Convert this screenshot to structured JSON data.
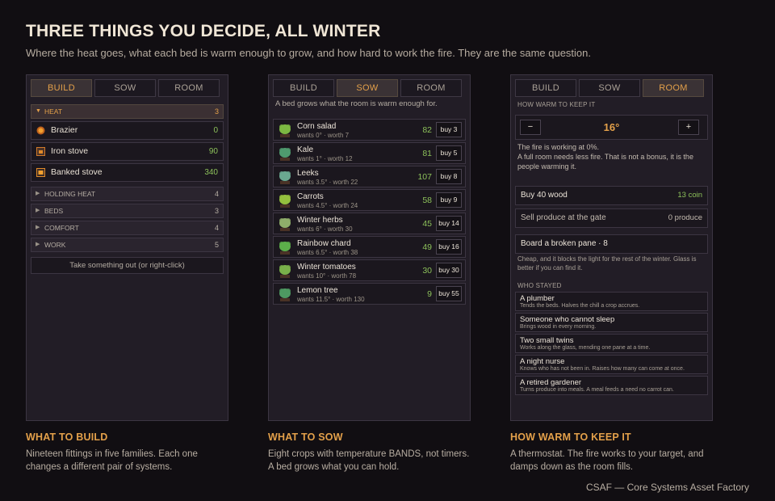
{
  "header": {
    "title": "THREE THINGS YOU DECIDE, ALL WINTER",
    "subtitle": "Where the heat goes, what each bed is warm enough to grow, and how hard to work the fire. They are the same question."
  },
  "tabs": [
    "BUILD",
    "SOW",
    "ROOM"
  ],
  "build": {
    "open_category": {
      "name": "HEAT",
      "count": "3"
    },
    "fittings": [
      {
        "name": "Brazier",
        "cost": "0",
        "icon": "brazier-icon"
      },
      {
        "name": "Iron stove",
        "cost": "90",
        "icon": "iron-stove-icon"
      },
      {
        "name": "Banked stove",
        "cost": "340",
        "icon": "banked-stove-icon"
      }
    ],
    "categories": [
      {
        "name": "HOLDING HEAT",
        "count": "4"
      },
      {
        "name": "BEDS",
        "count": "3"
      },
      {
        "name": "COMFORT",
        "count": "4"
      },
      {
        "name": "WORK",
        "count": "5"
      }
    ],
    "take_out": "Take something out  (or right-click)"
  },
  "sow": {
    "hint": "A bed grows what the room is warm enough for.",
    "crops": [
      {
        "name": "Corn salad",
        "meta": "wants 0°  ·  worth 7",
        "score": "82",
        "buy": "buy 3",
        "color": "#7cb842"
      },
      {
        "name": "Kale",
        "meta": "wants 1°  ·  worth 12",
        "score": "81",
        "buy": "buy 5",
        "color": "#4f9a6e"
      },
      {
        "name": "Leeks",
        "meta": "wants 3.5°  ·  worth 22",
        "score": "107",
        "buy": "buy 8",
        "color": "#6aa890"
      },
      {
        "name": "Carrots",
        "meta": "wants 4.5°  ·  worth 24",
        "score": "58",
        "buy": "buy 9",
        "color": "#94c03e"
      },
      {
        "name": "Winter herbs",
        "meta": "wants 6°  ·  worth 30",
        "score": "45",
        "buy": "buy 14",
        "color": "#8fae6a"
      },
      {
        "name": "Rainbow chard",
        "meta": "wants 6.5°  ·  worth 38",
        "score": "49",
        "buy": "buy 16",
        "color": "#5cae4a"
      },
      {
        "name": "Winter tomatoes",
        "meta": "wants 10°  ·  worth 78",
        "score": "30",
        "buy": "buy 30",
        "color": "#79b04a"
      },
      {
        "name": "Lemon tree",
        "meta": "wants 11.5°  ·  worth 130",
        "score": "9",
        "buy": "buy 55",
        "color": "#4e9a62"
      }
    ]
  },
  "room": {
    "section_warm": "HOW WARM TO KEEP IT",
    "minus": "−",
    "plus": "+",
    "temperature": "16°",
    "fire_status": "The fire is working at 0%.",
    "fire_note": "A full room needs less fire. That is not a bonus, it is the people warming it.",
    "buy_wood": {
      "label": "Buy 40 wood",
      "value": "13 coin"
    },
    "sell_produce": {
      "label": "Sell produce at the gate",
      "value": "0 produce"
    },
    "board_pane": "Board a broken pane  ·  8",
    "board_note": "Cheap, and it blocks the light for the rest of the winter. Glass is better if you can find it.",
    "section_stayed": "WHO STAYED",
    "people": [
      {
        "name": "A plumber",
        "desc": "Tends the beds. Halves the chill a crop accrues."
      },
      {
        "name": "Someone who cannot sleep",
        "desc": "Brings wood in every morning."
      },
      {
        "name": "Two small twins",
        "desc": "Works along the glass, mending one pane at a time."
      },
      {
        "name": "A night nurse",
        "desc": "Knows who has not been in. Raises how many can come at once."
      },
      {
        "name": "A retired gardener",
        "desc": "Turns produce into meals. A meal feeds a need no carrot can."
      }
    ]
  },
  "captions": [
    {
      "title": "WHAT TO BUILD",
      "body": "Nineteen fittings in five families. Each one changes a different pair of systems."
    },
    {
      "title": "WHAT TO SOW",
      "body": "Eight crops with temperature BANDS, not timers. A bed grows what you can hold."
    },
    {
      "title": "HOW WARM TO KEEP IT",
      "body": "A thermostat. The fire works to your target, and damps down as the room fills."
    }
  ],
  "credit": "CSAF — Core Systems Asset Factory"
}
